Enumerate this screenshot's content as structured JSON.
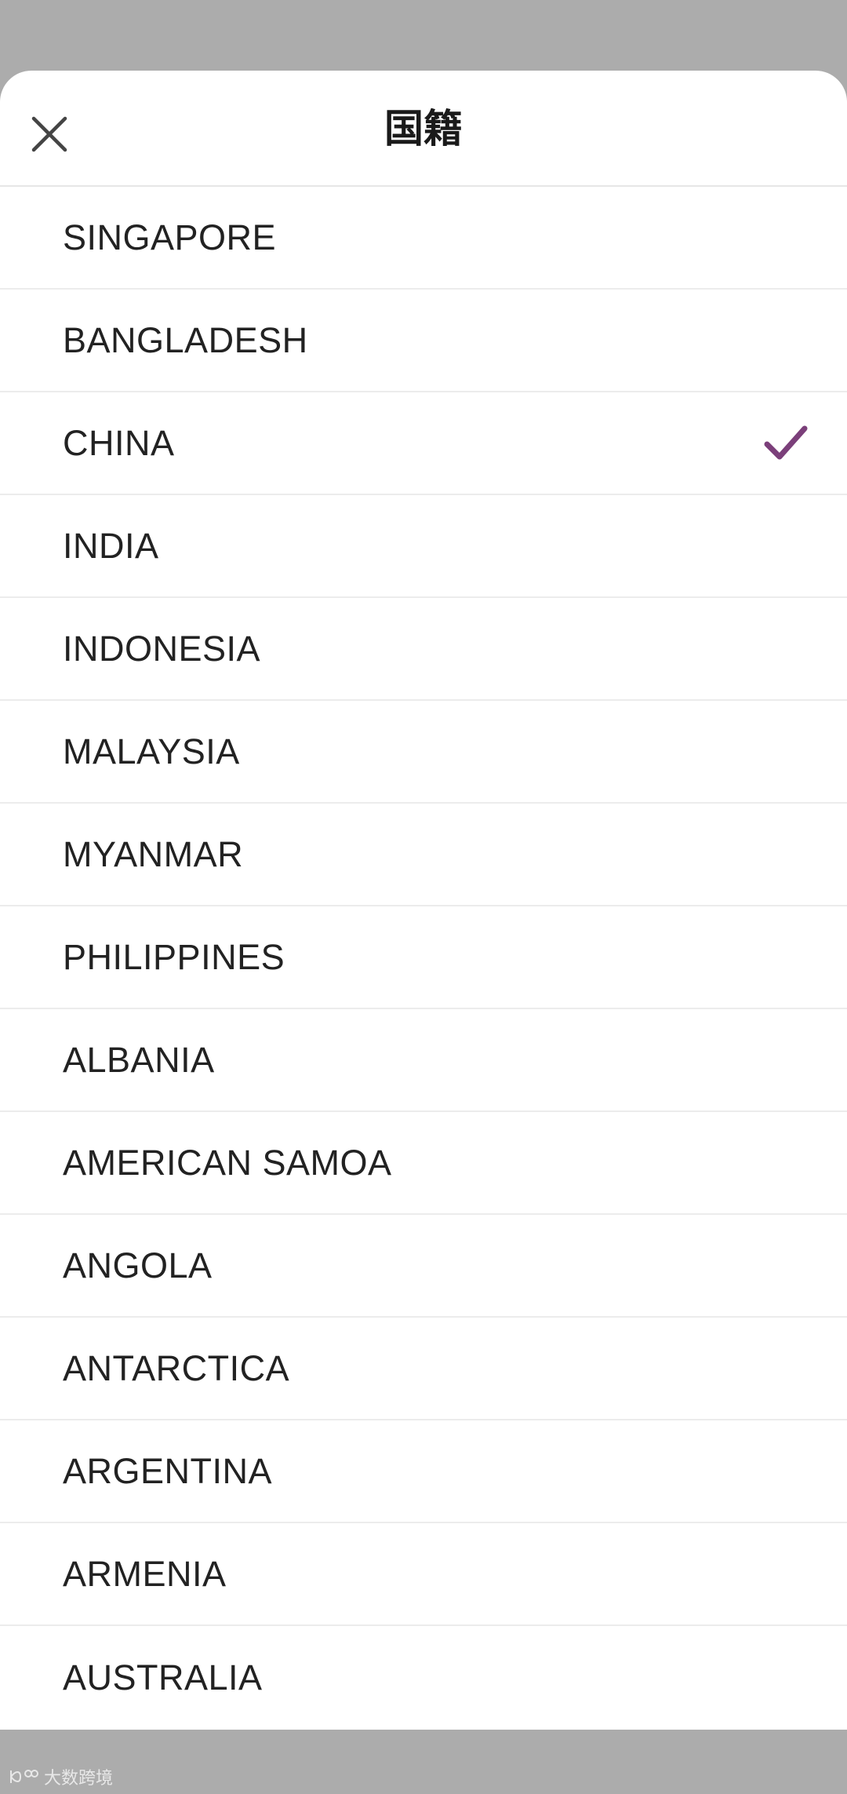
{
  "header": {
    "title": "国籍"
  },
  "countries": [
    {
      "name": "SINGAPORE",
      "selected": false
    },
    {
      "name": "BANGLADESH",
      "selected": false
    },
    {
      "name": "CHINA",
      "selected": true
    },
    {
      "name": "INDIA",
      "selected": false
    },
    {
      "name": "INDONESIA",
      "selected": false
    },
    {
      "name": "MALAYSIA",
      "selected": false
    },
    {
      "name": "MYANMAR",
      "selected": false
    },
    {
      "name": "PHILIPPINES",
      "selected": false
    },
    {
      "name": "ALBANIA",
      "selected": false
    },
    {
      "name": "AMERICAN SAMOA",
      "selected": false
    },
    {
      "name": "ANGOLA",
      "selected": false
    },
    {
      "name": "ANTARCTICA",
      "selected": false
    },
    {
      "name": "ARGENTINA",
      "selected": false
    },
    {
      "name": "ARMENIA",
      "selected": false
    },
    {
      "name": "AUSTRALIA",
      "selected": false
    }
  ],
  "icons": {
    "close": "close-icon",
    "selected": "checkmark-icon"
  },
  "colors": {
    "accent": "#7b3f7a",
    "scrim": "#acacac"
  },
  "watermark": {
    "text": "大数跨境"
  }
}
